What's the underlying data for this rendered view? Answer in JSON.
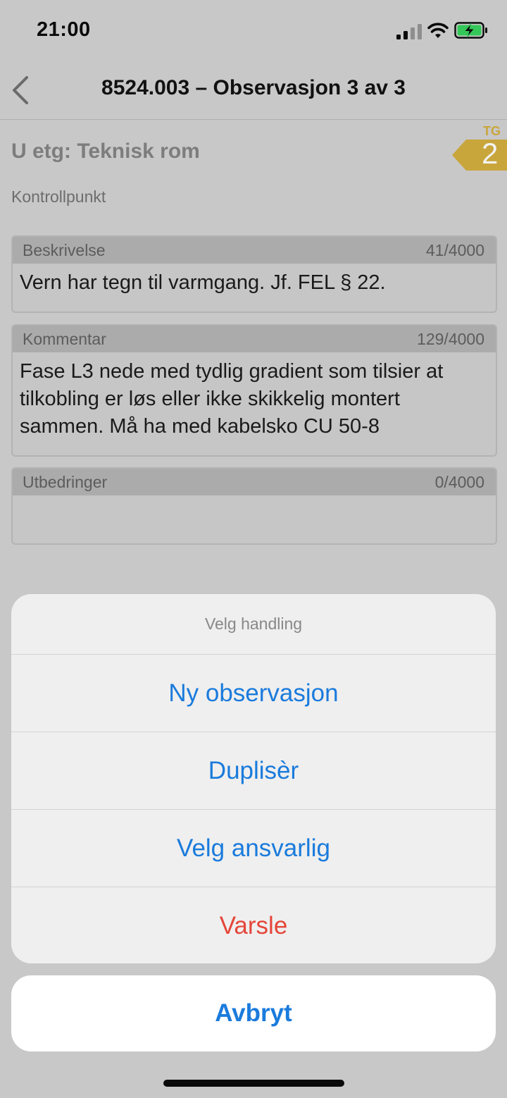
{
  "status": {
    "time": "21:00"
  },
  "nav": {
    "title": "8524.003 – Observasjon 3 av 3",
    "back_icon": "chevron-left-icon"
  },
  "location": "U etg: Teknisk rom",
  "tg": {
    "label": "TG",
    "value": "2",
    "color": "#c9a63c"
  },
  "section_label": "Kontrollpunkt",
  "fields": {
    "beskrivelse": {
      "label": "Beskrivelse",
      "count": "41/4000",
      "value": "Vern har tegn til varmgang. Jf. FEL § 22."
    },
    "kommentar": {
      "label": "Kommentar",
      "count": "129/4000",
      "value": "Fase L3 nede med tydlig gradient som tilsier at tilkobling er løs eller ikke skikkelig montert sammen. Må ha med kabelsko CU 50-8"
    },
    "utbedringer": {
      "label": "Utbedringer",
      "count": "0/4000",
      "value": ""
    }
  },
  "action_sheet": {
    "title": "Velg handling",
    "items": [
      "Ny observasjon",
      "Duplisèr",
      "Velg ansvarlig",
      "Varsle"
    ],
    "cancel": "Avbryt",
    "accent_color": "#1a7bdc",
    "destructive_color": "#e5463a"
  }
}
